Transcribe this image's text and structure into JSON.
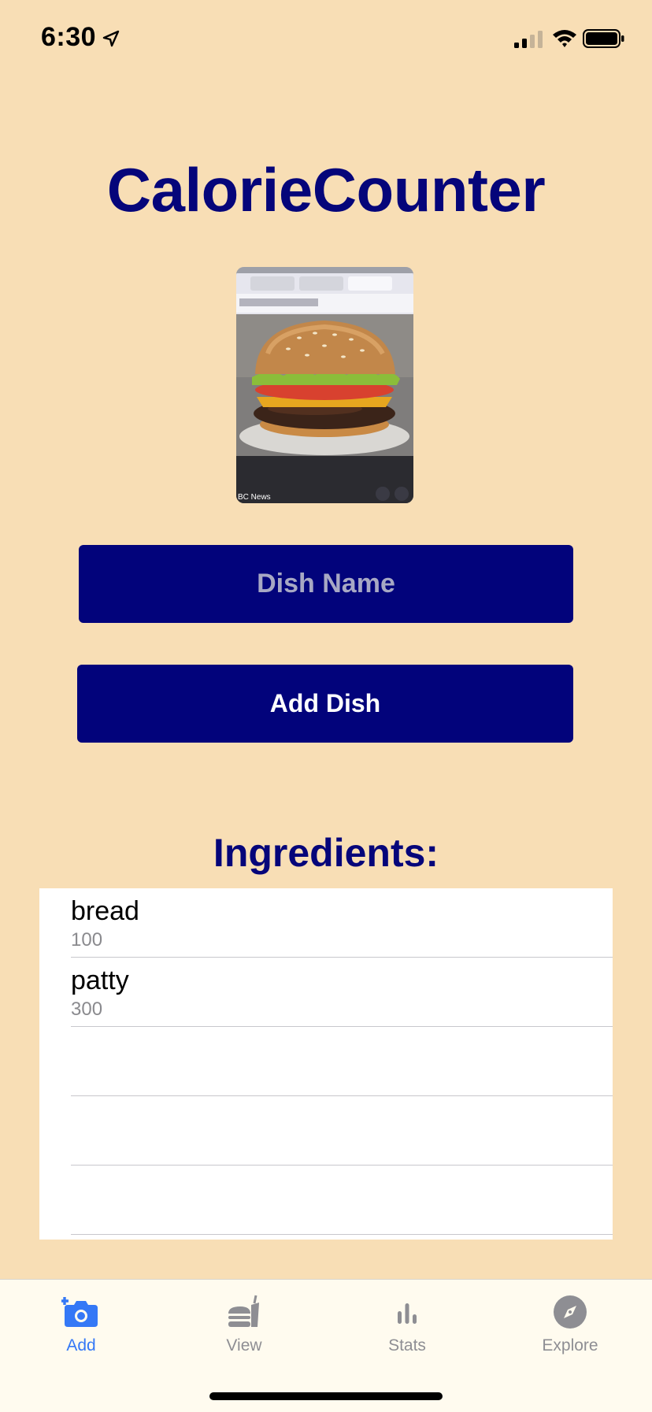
{
  "status_bar": {
    "time": "6:30"
  },
  "app": {
    "title": "CalorieCounter"
  },
  "dish": {
    "image_overlay_text": "BC News",
    "name_placeholder": "Dish Name",
    "add_button_label": "Add Dish"
  },
  "ingredients": {
    "heading": "Ingredients:",
    "items": [
      {
        "name": "bread",
        "calories": "100"
      },
      {
        "name": "patty",
        "calories": "300"
      }
    ]
  },
  "tab_bar": {
    "tabs": [
      {
        "label": "Add",
        "icon": "camera-plus-icon",
        "selected": true
      },
      {
        "label": "View",
        "icon": "food-icon",
        "selected": false
      },
      {
        "label": "Stats",
        "icon": "bar-chart-icon",
        "selected": false
      },
      {
        "label": "Explore",
        "icon": "compass-icon",
        "selected": false
      }
    ]
  },
  "colors": {
    "background": "#f8deb5",
    "accent_navy": "#02037b",
    "tab_selected": "#3478f6",
    "tab_unselected": "#8e8e93"
  }
}
